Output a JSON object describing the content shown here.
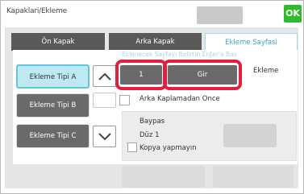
{
  "header": {
    "title": "Kapaklari/Ekleme",
    "ok_label": "OK"
  },
  "tabs": [
    {
      "label": "Ön Kapak",
      "active": false
    },
    {
      "label": "Arka Kapak",
      "active": false
    },
    {
      "label": "Ekleme Sayfasi",
      "active": true
    }
  ],
  "insert_settings": {
    "instruction_label": "Eklenecek Sayfayı Belirtin Enter'a Bas",
    "page_number_value": "1",
    "enter_button_label": "Gir",
    "ekleme_label": "Ekleme",
    "insert_types": [
      {
        "label": "Ekleme Tipi A",
        "selected": true
      },
      {
        "label": "Ekleme Tipi B",
        "selected": false
      },
      {
        "label": "Ekleme Tipi C",
        "selected": false
      }
    ],
    "before_back_cover_label": "Arka Kaplamadan Once",
    "tray_label": "Baypas",
    "paper_type_label": "Düz 1",
    "no_copy_label": "Kopya yapmayın"
  },
  "icons": {
    "scroll_up": "chevron-up-icon",
    "scroll_down": "chevron-down-icon"
  },
  "colors": {
    "ok_green": "#2fba2f",
    "highlight_red": "#e0203d",
    "selected_teal": "#63c5dc",
    "tab_active_text": "#37a5bd"
  }
}
